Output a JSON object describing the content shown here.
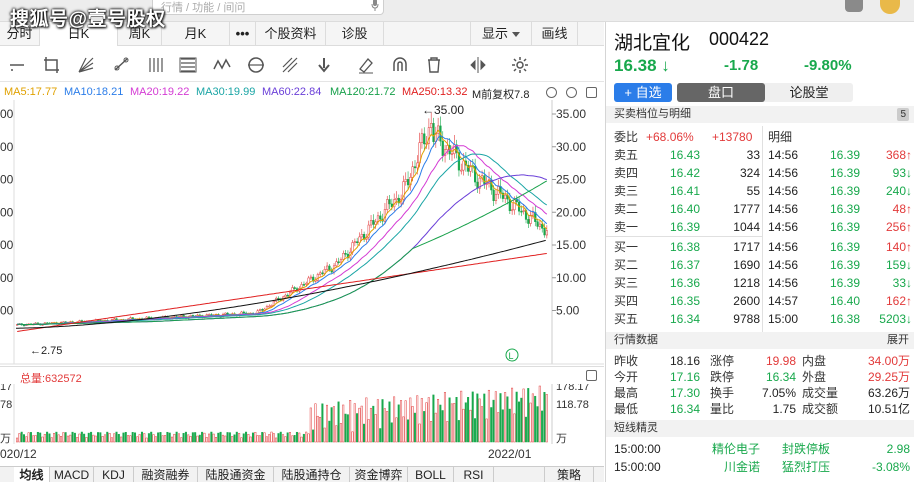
{
  "watermark": "搜狐号@壹号股权",
  "search": {
    "placeholder": "行情 / 功能 / 间问"
  },
  "period_tabs": [
    {
      "label": "分时"
    },
    {
      "label": "日K",
      "active": true
    },
    {
      "label": "周K"
    },
    {
      "label": "月K"
    },
    {
      "label": "•••"
    },
    {
      "label": "个股资料"
    },
    {
      "label": "诊股"
    }
  ],
  "toolbar_right": {
    "display_label": "显示",
    "draw_label": "画线"
  },
  "tool_icons": [
    "line-segment-icon",
    "crop-icon",
    "fan-icon",
    "pencil-line-icon",
    "parallel-lines-icon",
    "fib-icon",
    "wave-icon",
    "cycle-icon",
    "gann-icon",
    "arrow-down-icon",
    "eraser-icon",
    "magnet-icon",
    "trash-icon",
    "flip-icon",
    "settings-icon"
  ],
  "ma_legend": [
    {
      "label": "MA5:17.77",
      "color": "#e0a100"
    },
    {
      "label": "MA10:18.21",
      "color": "#2b7de9"
    },
    {
      "label": "MA20:19.22",
      "color": "#d43bd4"
    },
    {
      "label": "MA30:19.99",
      "color": "#1aa5a5"
    },
    {
      "label": "MA60:22.84",
      "color": "#6a3fd8"
    },
    {
      "label": "MA120:21.72",
      "color": "#17a04a"
    },
    {
      "label": "MA250:13.32",
      "color": "#e02020"
    },
    {
      "label": "M前复权7.8",
      "color": "#222222"
    }
  ],
  "price_axis": {
    "ticks": [
      "35.00",
      "30.00",
      "25.00",
      "20.00",
      "15.00",
      "10.00",
      "5.00"
    ],
    "left_ticks": [
      "00",
      "00",
      "00",
      "00",
      "00",
      "00",
      "00"
    ]
  },
  "annotations": {
    "high": "←35.00",
    "low": "←2.75",
    "l_mark": "L"
  },
  "volume": {
    "label": "总量:632572",
    "ticks": [
      "178.17",
      "118.78",
      "万"
    ],
    "left_ticks": [
      "17",
      "78",
      "万"
    ]
  },
  "dates": {
    "left": "020/12",
    "right": "2022/01"
  },
  "indicator_tabs": [
    {
      "label": "均线",
      "active": true
    },
    {
      "label": "MACD"
    },
    {
      "label": "KDJ"
    },
    {
      "label": "融资融券"
    },
    {
      "label": "陆股通资金"
    },
    {
      "label": "陆股通持仓"
    },
    {
      "label": "资金博弈"
    },
    {
      "label": "BOLL"
    },
    {
      "label": "RSI"
    },
    {
      "label": "策略"
    }
  ],
  "quote": {
    "name": "湖北宜化",
    "code": "000422",
    "price": "16.38",
    "arrow": "↓",
    "change": "-1.78",
    "pct": "-9.80%",
    "add_label": "+ 自选",
    "tabs": [
      {
        "label": "盘口",
        "active": true
      },
      {
        "label": "论股堂"
      }
    ]
  },
  "orderbook": {
    "header": "买卖档位与明细",
    "badge": "5",
    "weibi_label": "委比",
    "weibi_pct": "+68.06%",
    "weibi_num": "+13780",
    "detail_label": "明细",
    "asks": [
      {
        "label": "卖五",
        "price": "16.43",
        "vol": "33"
      },
      {
        "label": "卖四",
        "price": "16.42",
        "vol": "324"
      },
      {
        "label": "卖三",
        "price": "16.41",
        "vol": "55"
      },
      {
        "label": "卖二",
        "price": "16.40",
        "vol": "1777"
      },
      {
        "label": "卖一",
        "price": "16.39",
        "vol": "1044"
      }
    ],
    "bids": [
      {
        "label": "买一",
        "price": "16.38",
        "vol": "1717"
      },
      {
        "label": "买二",
        "price": "16.37",
        "vol": "1690"
      },
      {
        "label": "买三",
        "price": "16.36",
        "vol": "1218"
      },
      {
        "label": "买四",
        "price": "16.35",
        "vol": "2600"
      },
      {
        "label": "买五",
        "price": "16.34",
        "vol": "9788"
      }
    ],
    "ticks": [
      {
        "time": "14:56",
        "price": "16.39",
        "vol": "368↑",
        "dir": "up"
      },
      {
        "time": "14:56",
        "price": "16.39",
        "vol": "93↓",
        "dir": "down"
      },
      {
        "time": "14:56",
        "price": "16.39",
        "vol": "240↓",
        "dir": "down"
      },
      {
        "time": "14:56",
        "price": "16.39",
        "vol": "48↑",
        "dir": "up"
      },
      {
        "time": "14:56",
        "price": "16.39",
        "vol": "256↑",
        "dir": "up"
      },
      {
        "time": "14:56",
        "price": "16.39",
        "vol": "140↑",
        "dir": "up"
      },
      {
        "time": "14:56",
        "price": "16.39",
        "vol": "159↓",
        "dir": "down"
      },
      {
        "time": "14:56",
        "price": "16.39",
        "vol": "33↓",
        "dir": "down"
      },
      {
        "time": "14:57",
        "price": "16.40",
        "vol": "162↑",
        "dir": "up"
      },
      {
        "time": "15:00",
        "price": "16.38",
        "vol": "5203↓",
        "dir": "down"
      }
    ]
  },
  "market": {
    "header": "行情数据",
    "expand": "展开",
    "rows": [
      {
        "l1": "昨收",
        "v1": "18.16",
        "c1": "dark",
        "l2": "涨停",
        "v2": "19.98",
        "c2": "red",
        "l3": "内盘",
        "v3": "34.00万",
        "c3": "red"
      },
      {
        "l1": "今开",
        "v1": "17.16",
        "c1": "green",
        "l2": "跌停",
        "v2": "16.34",
        "c2": "green",
        "l3": "外盘",
        "v3": "29.25万",
        "c3": "red"
      },
      {
        "l1": "最高",
        "v1": "17.30",
        "c1": "green",
        "l2": "换手",
        "v2": "7.05%",
        "c2": "dark",
        "l3": "成交量",
        "v3": "63.26万",
        "c3": "dark"
      },
      {
        "l1": "最低",
        "v1": "16.34",
        "c1": "green",
        "l2": "量比",
        "v2": "1.75",
        "c2": "dark",
        "l3": "成交额",
        "v3": "10.51亿",
        "c3": "dark"
      }
    ]
  },
  "news": {
    "header": "短线精灵",
    "rows": [
      {
        "time": "15:00:00",
        "name": "精伦电子",
        "event": "封跌停板",
        "value": "2.98",
        "vcolor": "green"
      },
      {
        "time": "15:00:00",
        "name": "川金诺",
        "event": "猛烈打压",
        "value": "-3.08%",
        "vcolor": "green"
      }
    ]
  }
}
